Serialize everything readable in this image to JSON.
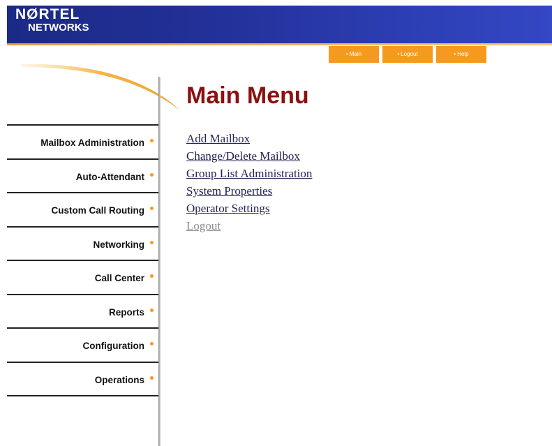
{
  "header": {
    "logo_top": "NØRTEL",
    "logo_bottom": "NETWORKS",
    "nav": [
      {
        "label": "Main"
      },
      {
        "label": "Logout"
      },
      {
        "label": "Help"
      }
    ]
  },
  "sidebar": {
    "items": [
      {
        "label": "Mailbox Administration"
      },
      {
        "label": "Auto-Attendant"
      },
      {
        "label": "Custom Call Routing"
      },
      {
        "label": "Networking"
      },
      {
        "label": "Call Center"
      },
      {
        "label": "Reports"
      },
      {
        "label": "Configuration"
      },
      {
        "label": "Operations"
      }
    ]
  },
  "main": {
    "title": "Main Menu",
    "links": [
      {
        "label": "Add Mailbox"
      },
      {
        "label": "Change/Delete Mailbox"
      },
      {
        "label": "Group List Administration"
      },
      {
        "label": "System Properties"
      },
      {
        "label": "Operator Settings"
      },
      {
        "label": "Logout"
      }
    ]
  },
  "colors": {
    "banner": "#23319a",
    "accent_orange": "#f59a1e",
    "title_red": "#8b1010",
    "link": "#222255",
    "link_muted": "#8a8a8a"
  }
}
